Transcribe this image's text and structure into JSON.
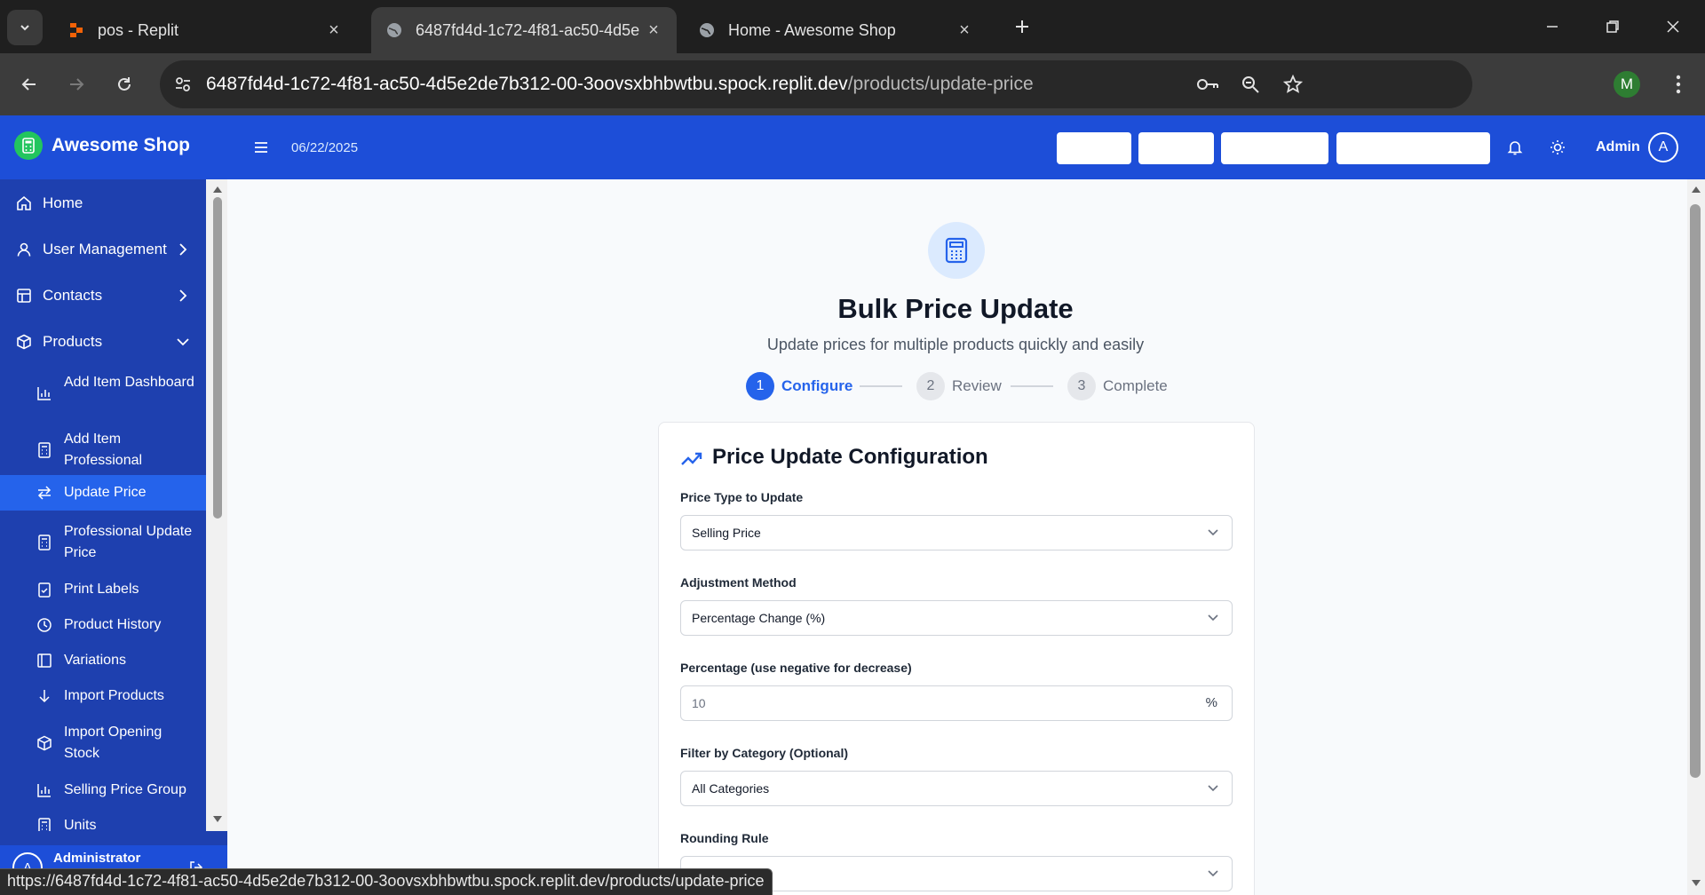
{
  "browser": {
    "tabs": [
      {
        "title": "pos - Replit"
      },
      {
        "title": "6487fd4d-1c72-4f81-ac50-4d5e"
      },
      {
        "title": "Home - Awesome Shop"
      }
    ],
    "url_host": "6487fd4d-1c72-4f81-ac50-4d5e2de7b312-00-3oovsxbhbwtbu.spock.replit.dev",
    "url_path": "/products/update-price",
    "profile_initial": "M",
    "status_url": "https://6487fd4d-1c72-4f81-ac50-4d5e2de7b312-00-3oovsxbhbwtbu.spock.replit.dev/products/update-price"
  },
  "header": {
    "brand": "Awesome Shop",
    "date": "06/22/2025",
    "user": "Admin",
    "avatar_initial": "A"
  },
  "sidebar": {
    "items": [
      {
        "label": "Home"
      },
      {
        "label": "User Management"
      },
      {
        "label": "Contacts"
      },
      {
        "label": "Products"
      }
    ],
    "sub_items": [
      {
        "label": "Add Item Dashboard"
      },
      {
        "label": "Add Item Professional"
      },
      {
        "label": "Update Price"
      },
      {
        "label": "Professional Update Price"
      },
      {
        "label": "Print Labels"
      },
      {
        "label": "Product History"
      },
      {
        "label": "Variations"
      },
      {
        "label": "Import Products"
      },
      {
        "label": "Import Opening Stock"
      },
      {
        "label": "Selling Price Group"
      },
      {
        "label": "Units"
      }
    ],
    "footer_name": "Administrator",
    "footer_initial": "A"
  },
  "main": {
    "title": "Bulk Price Update",
    "subtitle": "Update prices for multiple products quickly and easily",
    "steps": [
      {
        "num": "1",
        "label": "Configure"
      },
      {
        "num": "2",
        "label": "Review"
      },
      {
        "num": "3",
        "label": "Complete"
      }
    ],
    "card_title": "Price Update Configuration",
    "fields": {
      "price_type_label": "Price Type to Update",
      "price_type_value": "Selling Price",
      "method_label": "Adjustment Method",
      "method_value": "Percentage Change (%)",
      "percentage_label": "Percentage (use negative for decrease)",
      "percentage_placeholder": "10",
      "percentage_suffix": "%",
      "category_label": "Filter by Category (Optional)",
      "category_value": "All Categories",
      "rounding_label": "Rounding Rule"
    }
  },
  "colors": {
    "primary": "#1d4ed8",
    "sidebar": "#1e40af",
    "active_item": "#2563eb"
  }
}
